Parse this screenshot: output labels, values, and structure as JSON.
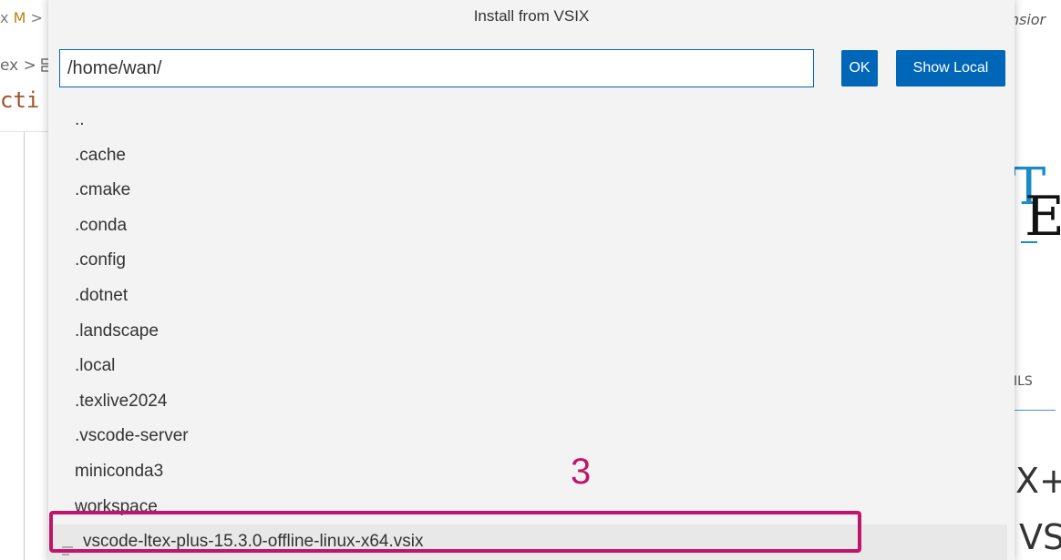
{
  "background": {
    "breadcrumb_top_prefix": "x",
    "breadcrumb_top_badge": "M",
    "breadcrumb_top_sep": ">",
    "breadcrumb_2_text": "ex",
    "breadcrumb_2_sep": ">",
    "code_fragment": "cti",
    "extension_title_fragment": "ensior",
    "logo_fragment": "TE",
    "tab_fragment": "ILS",
    "heading_fragment_1": "X+",
    "heading_fragment_2": "VS"
  },
  "quick_input": {
    "title": "Install from VSIX",
    "path_value": "/home/wan/",
    "ok_label": "OK",
    "show_local_label": "Show Local",
    "items": [
      {
        "label": "..",
        "type": "folder"
      },
      {
        "label": ".cache",
        "type": "folder"
      },
      {
        "label": ".cmake",
        "type": "folder"
      },
      {
        "label": ".conda",
        "type": "folder"
      },
      {
        "label": ".config",
        "type": "folder"
      },
      {
        "label": ".dotnet",
        "type": "folder"
      },
      {
        "label": ".landscape",
        "type": "folder"
      },
      {
        "label": ".local",
        "type": "folder"
      },
      {
        "label": ".texlive2024",
        "type": "folder"
      },
      {
        "label": ".vscode-server",
        "type": "folder"
      },
      {
        "label": "miniconda3",
        "type": "folder"
      },
      {
        "label": "workspace",
        "type": "folder"
      },
      {
        "label": "vscode-ltex-plus-15.3.0-offline-linux-x64.vsix",
        "type": "file",
        "icon": "file-lines-icon"
      }
    ]
  },
  "annotation": {
    "step_number": "3",
    "color": "#c0156b"
  },
  "colors": {
    "button_blue": "#0066b8",
    "input_border": "#0066b8",
    "panel_bg": "#f3f3f3",
    "selected_row_bg": "#e8e8e8"
  }
}
